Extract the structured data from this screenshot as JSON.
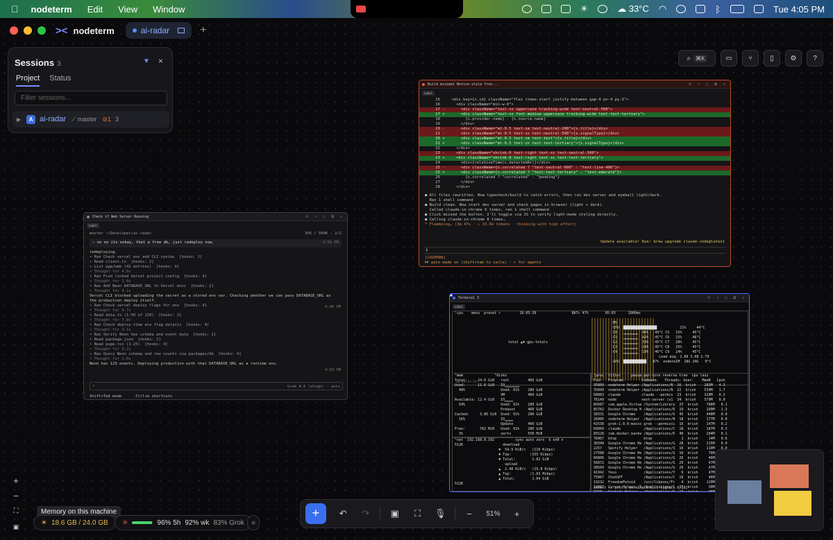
{
  "menubar": {
    "apple": "",
    "app": "nodeterm",
    "items": [
      "Edit",
      "View",
      "Window"
    ],
    "temperature": "33°C",
    "clock": "Tue 4:05 PM"
  },
  "titlebar": {
    "app_name": "nodeterm",
    "tab_label": "ai-radar",
    "add_tab": "+"
  },
  "sessions": {
    "title": "Sessions",
    "count": "3",
    "tabs": [
      "Project",
      "Status"
    ],
    "search_placeholder": "Filter sessions...",
    "row": {
      "caret": "▶",
      "badge": "A",
      "name": "ai-radar",
      "branch": "master",
      "changes": "1",
      "count": "3"
    },
    "close": "×"
  },
  "toolbar": {
    "search_kbd": "⌘K",
    "help": "?"
  },
  "term1": {
    "title": "Check if Web Server Running",
    "label": "Label",
    "path": "master ~/Developer/ai-radar",
    "tokens": "35K / 500K",
    "page": "2/2",
    "prompt": "› no no its ookay, that a free db, just redeploy now.",
    "prompt_time": "3:58 PM",
    "lines": [
      "redeploying.",
      "",
      "• Ran Check vercel env add CLI syntax  [hooks: 2]",
      "• Read client.ts  [hooks: 2]",
      "• List app/web (42 entries)  [hooks: 4]",
      "• Thought for 4.6s",
      "• Ran Find linked Vercel project config  [hooks: 4]",
      "• Thought for 1.0s",
      "• Ran Add Neon DATABASE_URL to Vercel envs  [hooks: 2]",
      "• Thought for 8.1s",
      "",
      "Vercel CLI blocked uploading the secret as a stored env var. Checking whether we can pass DATABASE_URL as",
      "the production deploy itself.",
      "",
      "• Ran Check vercel deploy flags for env  [hooks: 4]",
      "• Thought for 0.7s",
      "• Read data.ts (1-50 of 120)  [hooks: 2]",
      "• Thought for 7.9s",
      "• Ran Check deploy-time env flag details  [hooks: 4]",
      "• Thought for 3.1s",
      "• Ran Verify Neon has schema and event data  [hooks: 2]",
      "• Read package.json  [hooks: 2]",
      "• Read page.tsx (1-25)  [hooks: 4]",
      "• Thought for 3.2s",
      "• Ran Query Neon schema and row counts via packages/db  [hooks: 4]",
      "• Thought for 1.0s",
      "",
      "Neon has 123 events. Deploying production with that DATABASE_URL as a runtime env."
    ],
    "mid_time": "4:00 PM",
    "end_time": "4:03 PM",
    "input_prompt": "›",
    "model": "Grok 4.6 (xhigh) · auto",
    "footer_left": "Shift+Tab mode",
    "footer_right": "Ctrl+e shortcuts"
  },
  "term2": {
    "title": "Build minimal Notion-style fron...",
    "label": "Label",
    "diff": [
      {
        "n": "15",
        "m": " ",
        "t": "<div key={s.id} className=\"flex items-start justify-between gap-4 px-4 py-3\">",
        "k": "ctx"
      },
      {
        "n": "16",
        "m": " ",
        "t": "  <div className=\"min-w-0\">",
        "k": "ctx"
      },
      {
        "n": "17",
        "m": "-",
        "t": "    <div className=\"text-xs uppercase tracking-wide text-neutral-500\">",
        "k": "del"
      },
      {
        "n": "17",
        "m": "+",
        "t": "    <div className=\"text-xs font-medium uppercase tracking-wide text-text-tertiary\">",
        "k": "add"
      },
      {
        "n": "18",
        "m": " ",
        "t": "      {s.provider.name} · {s.source.name}",
        "k": "ctx"
      },
      {
        "n": "19",
        "m": " ",
        "t": "    </div>",
        "k": "ctx"
      },
      {
        "n": "20",
        "m": "-",
        "t": "    <div className=\"mt-0.5 text-sm text-neutral-200\">{s.title}</div>",
        "k": "del"
      },
      {
        "n": "21",
        "m": "-",
        "t": "    <div className=\"mt-0.5 text-xs text-neutral-500\">{s.signalType}</div>",
        "k": "del"
      },
      {
        "n": "20",
        "m": "+",
        "t": "    <div className=\"mt-0.5 text-sm text-text\">{s.title}</div>",
        "k": "add"
      },
      {
        "n": "21",
        "m": "+",
        "t": "    <div className=\"mt-0.5 text-xs text-text-tertiary\">{s.signalType}</div>",
        "k": "add"
      },
      {
        "n": "22",
        "m": " ",
        "t": "  </div>",
        "k": "ctx"
      },
      {
        "n": "23",
        "m": "-",
        "t": "  <div className=\"shrink-0 text-right text-xs text-neutral-500\">",
        "k": "del"
      },
      {
        "n": "23",
        "m": "+",
        "t": "  <div className=\"shrink-0 text-right text-xs text-text-tertiary\">",
        "k": "add"
      },
      {
        "n": "24",
        "m": " ",
        "t": "    <div>{relativeTime(s.detectedAt)}</div>",
        "k": "ctx"
      },
      {
        "n": "25",
        "m": "-",
        "t": "    <div className={s.correlated ? \"text-neutral-600\" : \"text-line-400\"}>",
        "k": "del"
      },
      {
        "n": "25",
        "m": "+",
        "t": "    <div className={s.correlated ? \"text-text-tertiary\" : \"text-emerald\"}>",
        "k": "add"
      },
      {
        "n": "26",
        "m": " ",
        "t": "      {s.correlated ? \"correlated\" : \"pending\"}",
        "k": "ctx"
      },
      {
        "n": "27",
        "m": " ",
        "t": "    </div>",
        "k": "ctx"
      },
      {
        "n": "28",
        "m": " ",
        "t": "  </div>",
        "k": "ctx"
      }
    ],
    "after": [
      "● All files rewritten. Now typecheck/build to catch errors, then run dev server and eyeball light/dark.",
      "",
      "  Ran 1 shell command",
      "",
      "● Build clean. Now start dev server and check pages in browser (light + dark).",
      "",
      "  Called claude-in-chrome 6 times, ran 1 shell command",
      "",
      "● Click missed the button. I'll toggle via JS to verify light-mode styling directly.",
      "",
      "● Calling claude-in-chrome 8 times…"
    ],
    "thinking": "* Flambéing… (3m 47s · ↓ 15.6k tokens · thinking with high effort)",
    "update": "Update available! Run: brew upgrade claude-code@latest",
    "prompt": "❯",
    "caveman": "[CAVEMAN]",
    "automode": "⏵⏵ auto mode on (shift+tab to cycle) · ← for agents"
  },
  "term3": {
    "title": "Terminal 3",
    "label": "Label",
    "cpu_header": "¹cpu    menu  preset •         16:05:39                 BAT▾ 47%        05:03      2000ms",
    "total_label": "total ▲▼ gpu-totals",
    "uptime": "up 22:47:54",
    "cpu_rows": [
      "M5",
      "CPU  ████████████████           21%     44°C",
      "C0   ▁▁▁▁▁▁▁  46%   49°C C5   15%     45°C",
      "C1   ▁▁▁▁▁▁▁  42%   45°C C6   15%     46°C",
      "C2   ▁▁▁▁▁▁▁  33%   45°C C7   28%     45°C",
      "C3   ▁▁▁▁▁▁▁  24%   45°C C8   25%     45°C",
      "C4   ▁▁▁▁▁▁▁  19%   46°C C9   24%     45°C",
      "                      Load avg: 2.89 3.08 2.79",
      "GPU  ███████████   87%  nodeteIM  18G 24G   0°C"
    ],
    "mem_rows": [
      "¹mem               ³disks",
      "Total:     24.0 GiB   root         460 GiB",
      "Used:      11.6 GiB   IO▁▁▁▁▁▁▁",
      "  48%                 Used: 61%    280 GiB",
      "                      VM           460 GiB",
      "Available: 12.4 GiB   IO▁▁▁▁",
      "  54%                 Used: 61%    280 GiB",
      "                      Preboot      460 GiB",
      "Cached:     3.86 GiB  Used: 61%    280 GiB",
      "  16%                 IO▁▁▁▁",
      "                      Update       460 GiB",
      "Free:       762 MiB   Used: 61%    280 GiB",
      "  3%                  xarts        550 MiB"
    ],
    "proc_rows": [
      "¹proc  filter     pause per-core reverse tree  cpu lazy",
      "Pid:   Program:        Command:   Threads: User:    MemB   Cpu%",
      "35809  nodeterm Helper /Applications/N  16  krish    283M   4.3",
      "35899  nodeterm Helper /Applications/N  22  krish    539M   1.7",
      "68883  claude          claude --permis  23  krish    328M   0.2",
      "76149  node            next-server (v1  34  krish    579M   0.0",
      "85687  com.apple.Virtua /System/Library  25  krish    786M   0.1",
      "85782  Docker Desktop H /Applications/D  19  krish    109M   1.3",
      "38331  Google Chrome    /Applications/G  45  krish    448M   0.0",
      "26085  nodeterm Helper  /Applications/N  18  krish    177M   0.0",
      "42538  grok-1.0.0-macos grok --permissi  16  krish    147M   0.2",
      "69069  claude           /Applications/C  18  krish    187M   0.3",
      "85528  com.docker.backe /Applications/D  40  krish    204M   0.1",
      "78467  btop             btop              1  krish     14M   0.6",
      "38349  Google Chrome He /Applications/G  28  krish    215M   0.0",
      "2257   Spotify Helper   /Applications/S  16  krish    110M   0.0",
      "27588  Google Chrome He /Applications/G  16  krish     76M   0.0",
      "66806  Google Chrome He /Applications/G  26  krish     46M   0.0",
      "56872  Google Chrome He /Applications/G  29  krish     47M   0.0",
      "38569  Google Chrome He /Applications/G  20  krish     47M   0.0",
      "41942  Yeso             /Applications/Y   6  krish     47M   0.0",
      "75867  ChatGPT          /Applications/C  19  krish     46M   0.0",
      "19232  FreedomFetoid    /usr/libexec/Fr   4  krish    120M   0.0",
      "19887  Cursor Helper (R /Applications/C  17  krish     30M   0.0",
      "3210   Spotify Helper   /Applications/S  17  krish     36M   0.0"
    ],
    "net_rows": [
      "¹net  192.168.0.102          sync auto zero  b en0 n",
      "512K                   download",
      "                     ▼  54.9 KiB/s   (119 Kibps)",
      "                     ▼ Top:         (155 Kibps)",
      "                     ▼ Total:        1.02 GiB",
      "                        upload",
      "                     ▲  2.48 KiB/s   (19.8 Kibps)",
      "                     ▲ Top:         (1.63 Mibps)",
      "                     ▲ Total:        1.04 GiB",
      "512K"
    ],
    "proc_footer": "select ↑↓ info ↵ terminate kill signals 0/102"
  },
  "zoom_controls": {
    "zoom_in": "+",
    "zoom_out": "−",
    "fit": "⛶",
    "lock": "🔒"
  },
  "status": {
    "memory_tooltip": "Memory on this machine",
    "memory": "18.6 GB / 24.0 GB",
    "usage_5h_pct": 96,
    "usage_5h": "96% 5h",
    "usage_wk": "92% wk",
    "grok": "83% Grok"
  },
  "bottombar": {
    "add": "+",
    "zoom_out": "−",
    "zoom": "51%",
    "zoom_in": "+"
  }
}
